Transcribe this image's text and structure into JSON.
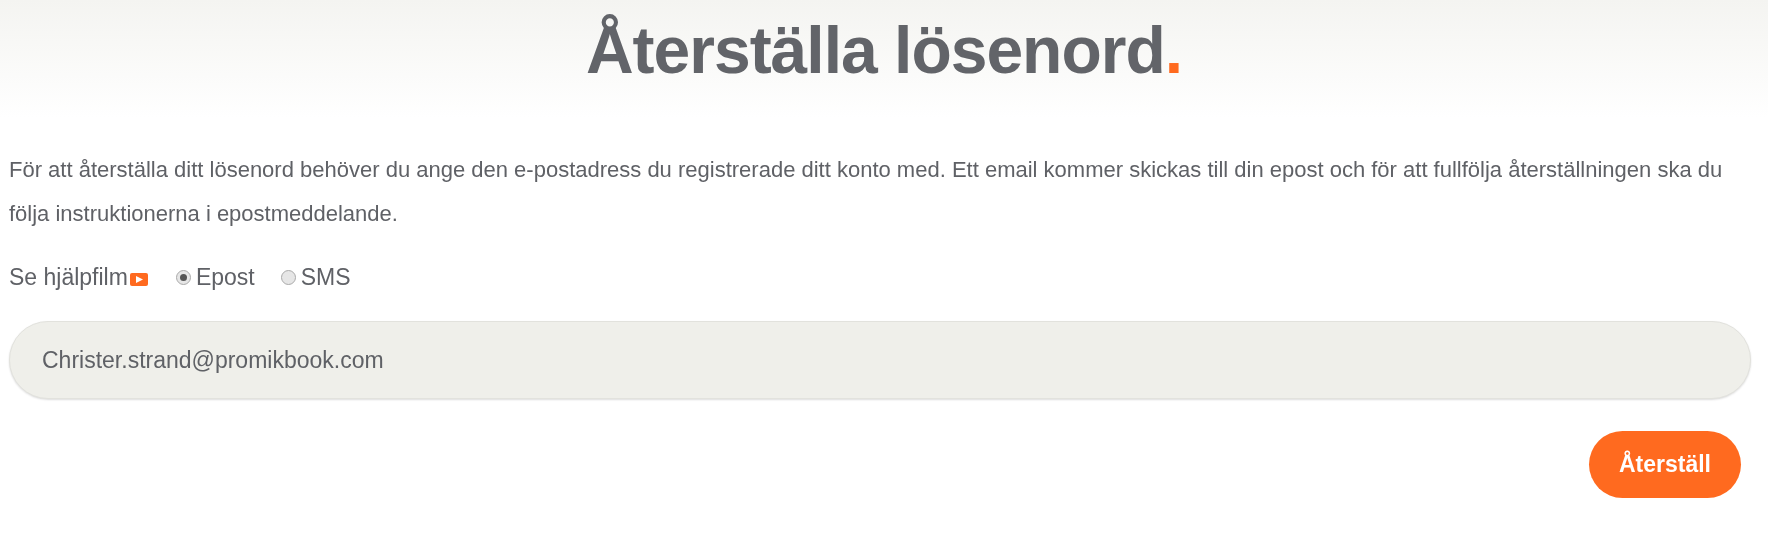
{
  "title": {
    "text": "Återställa lösenord",
    "mark": "."
  },
  "description": "För att återställa ditt lösenord behöver du ange den e-postadress du registrerade ditt konto med. Ett email kommer skickas till din epost och för att fullfölja återställningen ska du följa instruktionerna i epostmeddelande.",
  "help_link": "Se hjälpfilm",
  "methods": [
    {
      "label": "Epost",
      "selected": true
    },
    {
      "label": "SMS",
      "selected": false
    }
  ],
  "email_field": {
    "value": "Christer.strand@promikbook.com"
  },
  "submit_button": "Återställ"
}
